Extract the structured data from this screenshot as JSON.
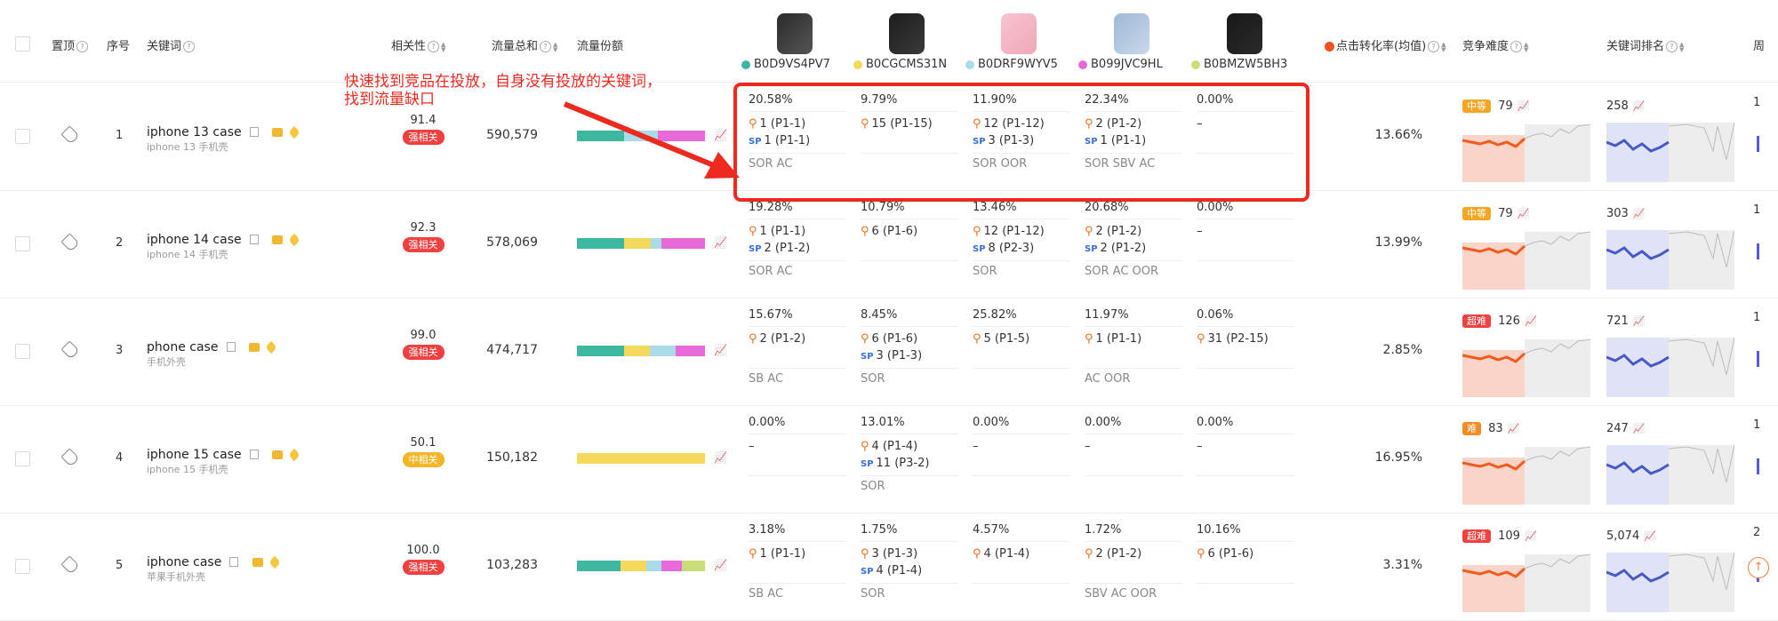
{
  "header": {
    "pin": "置顶",
    "index": "序号",
    "keyword": "关键词",
    "relevance": "相关性",
    "traffic_total": "流量总和",
    "traffic_share": "流量份额",
    "ctr": "点击转化率(均值)",
    "competition": "竞争难度",
    "rank": "关键词排名",
    "more": "周"
  },
  "products": [
    {
      "asin": "B0D9VS4PV7",
      "color": "#3cb8a0"
    },
    {
      "asin": "B0CGCMS31N",
      "color": "#f5d95a"
    },
    {
      "asin": "B0DRF9WYV5",
      "color": "#a9dbe8"
    },
    {
      "asin": "B099JVC9HL",
      "color": "#e86ad8"
    },
    {
      "asin": "B0BMZW5BH3",
      "color": "#c8dc78"
    }
  ],
  "annotation": {
    "line1": "快速找到竞品在投放，自身没有投放的关键词，",
    "line2": "找到流量缺口"
  },
  "rows": [
    {
      "idx": "1",
      "kw": "iphone 13 case",
      "kw_cn": "iphone 13 手机壳",
      "rel": "91.4",
      "rel_tag": "强相关",
      "rel_color": "#f04040",
      "traffic": "590,579",
      "ctr": "13.66%",
      "diff_tag": "中等",
      "diff_color": "#f5a623",
      "diff_val": "79",
      "rank": "258",
      "share": [
        0.37,
        0.0,
        0.26,
        0.37,
        0.0
      ],
      "cells": [
        {
          "pct": "20.58%",
          "lines": [
            {
              "t": "q",
              "v": "1 (P1-1)"
            },
            {
              "t": "sp",
              "v": "1 (P1-1)"
            }
          ],
          "tags": "SOR AC"
        },
        {
          "pct": "9.79%",
          "lines": [
            {
              "t": "q",
              "v": "15 (P1-15)"
            }
          ],
          "tags": ""
        },
        {
          "pct": "11.90%",
          "lines": [
            {
              "t": "q",
              "v": "12 (P1-12)"
            },
            {
              "t": "sp",
              "v": "3 (P1-3)"
            }
          ],
          "tags": "SOR OOR"
        },
        {
          "pct": "22.34%",
          "lines": [
            {
              "t": "q",
              "v": "2 (P1-2)"
            },
            {
              "t": "sp",
              "v": "1 (P1-1)"
            }
          ],
          "tags": "SOR SBV AC"
        },
        {
          "pct": "0.00%",
          "lines": [
            {
              "t": "n",
              "v": "–"
            }
          ],
          "tags": ""
        }
      ]
    },
    {
      "idx": "2",
      "kw": "iphone 14 case",
      "kw_cn": "iphone 14 手机壳",
      "rel": "92.3",
      "rel_tag": "强相关",
      "rel_color": "#f04040",
      "traffic": "578,069",
      "ctr": "13.99%",
      "diff_tag": "中等",
      "diff_color": "#f5a623",
      "diff_val": "79",
      "rank": "303",
      "share": [
        0.37,
        0.21,
        0.08,
        0.34,
        0.0
      ],
      "cells": [
        {
          "pct": "19.28%",
          "lines": [
            {
              "t": "q",
              "v": "1 (P1-1)"
            },
            {
              "t": "sp",
              "v": "2 (P1-2)"
            }
          ],
          "tags": "SOR AC"
        },
        {
          "pct": "10.79%",
          "lines": [
            {
              "t": "q",
              "v": "6 (P1-6)"
            }
          ],
          "tags": ""
        },
        {
          "pct": "13.46%",
          "lines": [
            {
              "t": "q",
              "v": "12 (P1-12)"
            },
            {
              "t": "sp",
              "v": "8 (P2-3)"
            }
          ],
          "tags": "SOR"
        },
        {
          "pct": "20.68%",
          "lines": [
            {
              "t": "q",
              "v": "2 (P1-2)"
            },
            {
              "t": "sp",
              "v": "2 (P1-2)"
            }
          ],
          "tags": "SOR AC OOR"
        },
        {
          "pct": "0.00%",
          "lines": [
            {
              "t": "n",
              "v": "–"
            }
          ],
          "tags": ""
        }
      ]
    },
    {
      "idx": "3",
      "kw": "phone case",
      "kw_cn": "手机外壳",
      "rel": "99.0",
      "rel_tag": "强相关",
      "rel_color": "#f04040",
      "traffic": "474,717",
      "ctr": "2.85%",
      "diff_tag": "超难",
      "diff_color": "#f04040",
      "diff_val": "126",
      "rank": "721",
      "share": [
        0.37,
        0.2,
        0.2,
        0.23,
        0.0
      ],
      "cells": [
        {
          "pct": "15.67%",
          "lines": [
            {
              "t": "q",
              "v": "2 (P1-2)"
            }
          ],
          "tags": "SB AC"
        },
        {
          "pct": "8.45%",
          "lines": [
            {
              "t": "q",
              "v": "6 (P1-6)"
            },
            {
              "t": "sp",
              "v": "3 (P1-3)"
            }
          ],
          "tags": "SOR"
        },
        {
          "pct": "25.82%",
          "lines": [
            {
              "t": "q",
              "v": "5 (P1-5)"
            }
          ],
          "tags": ""
        },
        {
          "pct": "11.97%",
          "lines": [
            {
              "t": "q",
              "v": "1 (P1-1)"
            }
          ],
          "tags": "AC OOR"
        },
        {
          "pct": "0.06%",
          "lines": [
            {
              "t": "q",
              "v": "31 (P2-15)"
            }
          ],
          "tags": ""
        }
      ]
    },
    {
      "idx": "4",
      "kw": "iphone 15 case",
      "kw_cn": "iphone 15 手机壳",
      "rel": "50.1",
      "rel_tag": "中相关",
      "rel_color": "#f5b528",
      "traffic": "150,182",
      "ctr": "16.95%",
      "diff_tag": "难",
      "diff_color": "#f58a23",
      "diff_val": "83",
      "rank": "247",
      "share": [
        0.0,
        1.0,
        0.0,
        0.0,
        0.0
      ],
      "cells": [
        {
          "pct": "0.00%",
          "lines": [
            {
              "t": "n",
              "v": "–"
            }
          ],
          "tags": ""
        },
        {
          "pct": "13.01%",
          "lines": [
            {
              "t": "q",
              "v": "4 (P1-4)"
            },
            {
              "t": "sp",
              "v": "11 (P3-2)"
            }
          ],
          "tags": "SOR"
        },
        {
          "pct": "0.00%",
          "lines": [
            {
              "t": "n",
              "v": "–"
            }
          ],
          "tags": ""
        },
        {
          "pct": "0.00%",
          "lines": [
            {
              "t": "n",
              "v": "–"
            }
          ],
          "tags": ""
        },
        {
          "pct": "0.00%",
          "lines": [
            {
              "t": "n",
              "v": "–"
            }
          ],
          "tags": ""
        }
      ]
    },
    {
      "idx": "5",
      "kw": "iphone case",
      "kw_cn": "苹果手机外壳",
      "rel": "100.0",
      "rel_tag": "强相关",
      "rel_color": "#f04040",
      "traffic": "103,283",
      "ctr": "3.31%",
      "diff_tag": "超难",
      "diff_color": "#f04040",
      "diff_val": "109",
      "rank": "5,074",
      "share": [
        0.34,
        0.2,
        0.12,
        0.16,
        0.18
      ],
      "cells": [
        {
          "pct": "3.18%",
          "lines": [
            {
              "t": "q",
              "v": "1 (P1-1)"
            }
          ],
          "tags": "SB AC"
        },
        {
          "pct": "1.75%",
          "lines": [
            {
              "t": "q",
              "v": "3 (P1-3)"
            },
            {
              "t": "sp",
              "v": "4 (P1-4)"
            }
          ],
          "tags": "SOR"
        },
        {
          "pct": "4.57%",
          "lines": [
            {
              "t": "q",
              "v": "4 (P1-4)"
            }
          ],
          "tags": ""
        },
        {
          "pct": "1.72%",
          "lines": [
            {
              "t": "q",
              "v": "2 (P1-2)"
            }
          ],
          "tags": "SBV AC OOR"
        },
        {
          "pct": "10.16%",
          "lines": [
            {
              "t": "q",
              "v": "6 (P1-6)"
            }
          ],
          "tags": ""
        }
      ]
    }
  ],
  "edge_values": [
    "1",
    "1",
    "1",
    "1",
    "2"
  ]
}
